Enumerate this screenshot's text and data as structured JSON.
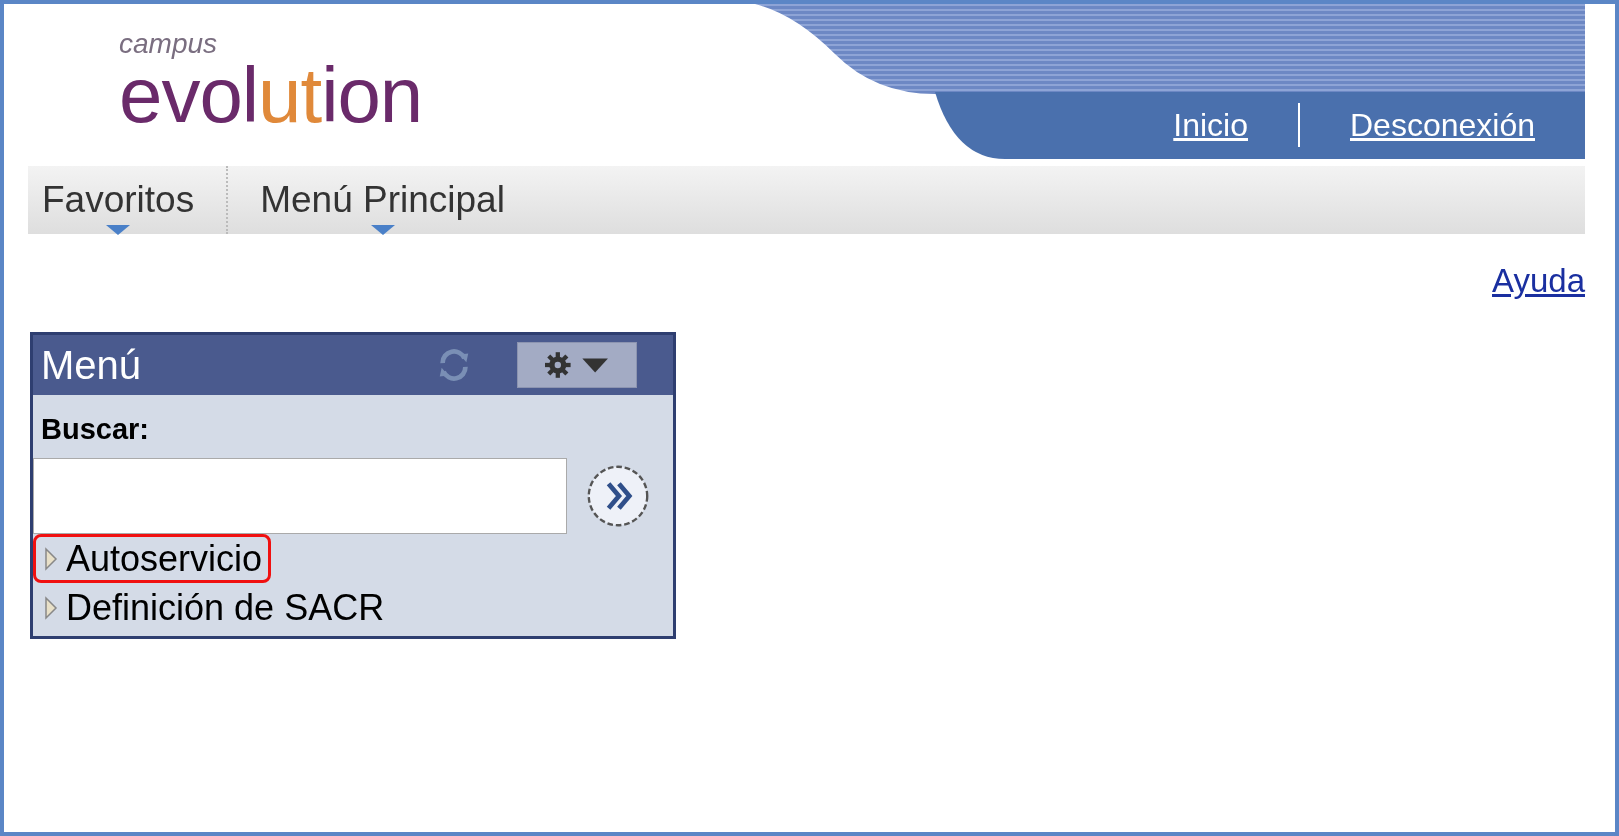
{
  "logo": {
    "small": "campus",
    "large_start": "evol",
    "large_highlight": "ut",
    "large_end": "ion"
  },
  "header_links": [
    {
      "label": "Inicio"
    },
    {
      "label": "Desconexión"
    }
  ],
  "nav": [
    {
      "label": "Favoritos",
      "has_dropdown": true
    },
    {
      "label": "Menú Principal",
      "has_dropdown": true
    }
  ],
  "help_link": "Ayuda",
  "menu": {
    "title": "Menú",
    "search_label": "Buscar:",
    "items": [
      {
        "label": "Autoservicio",
        "expanded": false,
        "highlighted": true
      },
      {
        "label": "Definición de SACR",
        "expanded": false,
        "highlighted": false
      }
    ]
  }
}
